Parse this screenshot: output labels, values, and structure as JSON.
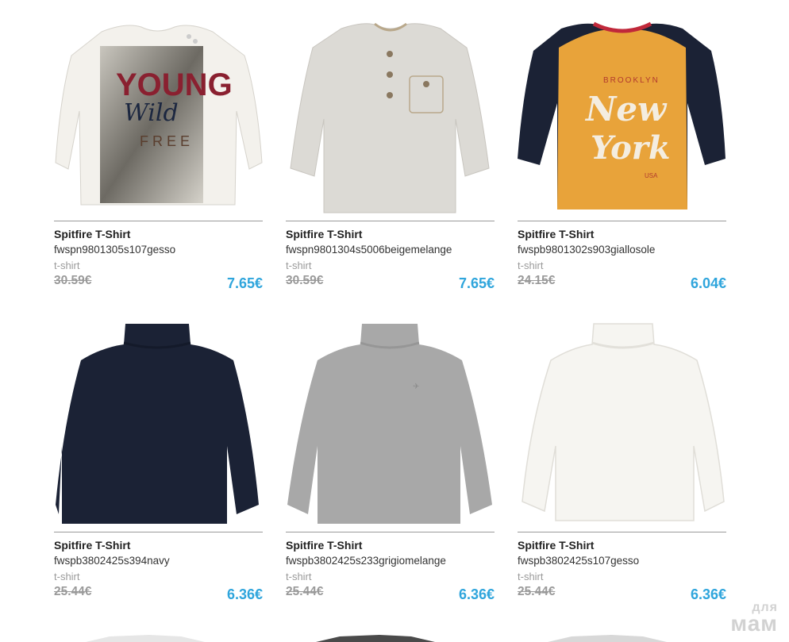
{
  "products": [
    {
      "name": "Spitfire T-Shirt",
      "sku": "fwspn9801305s107gesso",
      "type": "t-shirt",
      "old_price": "30.59€",
      "new_price": "7.65€",
      "image": "young-wild-free-tshirt"
    },
    {
      "name": "Spitfire T-Shirt",
      "sku": "fwspn9801304s5006beigemelange",
      "type": "t-shirt",
      "old_price": "30.59€",
      "new_price": "7.65€",
      "image": "beige-henley-tshirt"
    },
    {
      "name": "Spitfire T-Shirt",
      "sku": "fwspb9801302s903giallosole",
      "type": "t-shirt",
      "old_price": "24.15€",
      "new_price": "6.04€",
      "image": "new-york-raglan-tshirt"
    },
    {
      "name": "Spitfire T-Shirt",
      "sku": "fwspb3802425s394navy",
      "type": "t-shirt",
      "old_price": "25.44€",
      "new_price": "6.36€",
      "image": "navy-turtleneck"
    },
    {
      "name": "Spitfire T-Shirt",
      "sku": "fwspb3802425s233grigiomelange",
      "type": "t-shirt",
      "old_price": "25.44€",
      "new_price": "6.36€",
      "image": "grey-turtleneck"
    },
    {
      "name": "Spitfire T-Shirt",
      "sku": "fwspb3802425s107gesso",
      "type": "t-shirt",
      "old_price": "25.44€",
      "new_price": "6.36€",
      "image": "white-turtleneck"
    }
  ],
  "print_text": {
    "young": "YOUNG",
    "wild": "Wild",
    "free": "FREE",
    "brooklyn": "BROOKLYN",
    "new": "New",
    "york": "York",
    "usa": "USA"
  },
  "watermark": {
    "small": "для",
    "big": "мам"
  },
  "colors": {
    "price_accent": "#2fa5dc",
    "old_price": "#9a9a9a",
    "navy": "#1b2235",
    "mustard": "#e8a33a",
    "grey": "#a8a8a8",
    "offwhite": "#f6f5f1",
    "beige_melange": "#dcdad5"
  }
}
